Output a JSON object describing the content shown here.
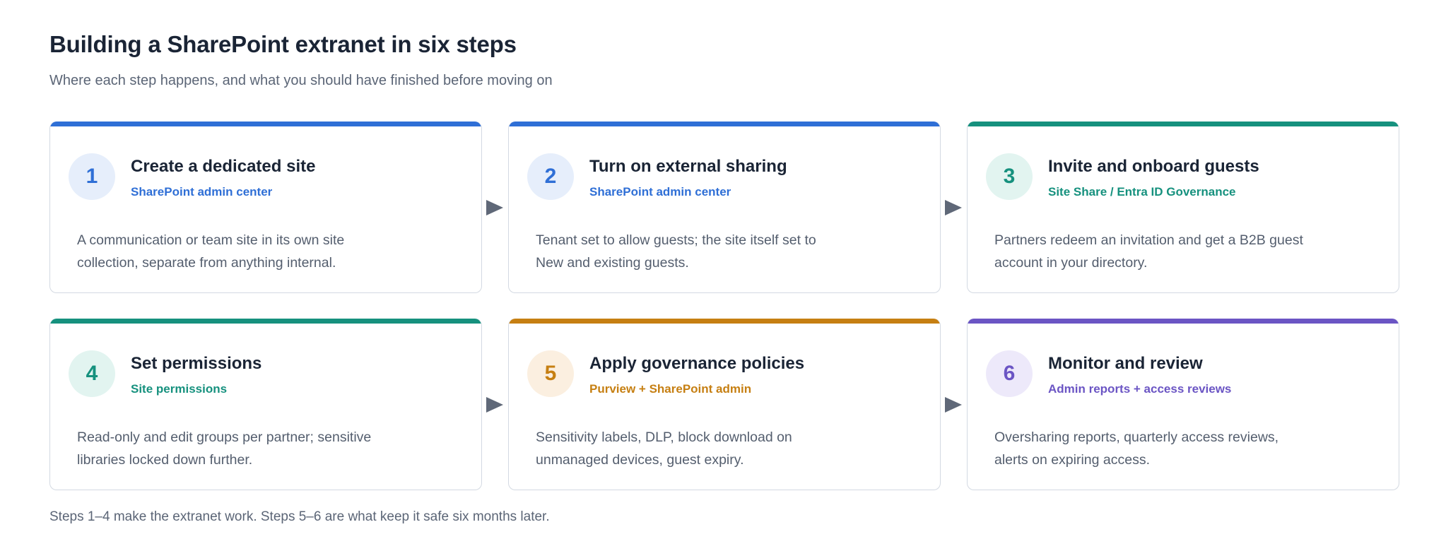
{
  "title": "Building a SharePoint extranet in six steps",
  "subtitle": "Where each step happens, and what you should have finished before moving on",
  "steps": [
    {
      "number": "1",
      "title": "Create a dedicated site",
      "location": "SharePoint admin center",
      "description": "A communication or team site in its own site collection, separate from anything internal.",
      "accent": "#2f6fd6",
      "badge_bg": "#e6eefb"
    },
    {
      "number": "2",
      "title": "Turn on external sharing",
      "location": "SharePoint admin center",
      "description": "Tenant set to allow guests; the site itself set to New and existing guests.",
      "accent": "#2f6fd6",
      "badge_bg": "#e6eefb"
    },
    {
      "number": "3",
      "title": "Invite and onboard guests",
      "location": "Site Share / Entra ID Governance",
      "description": "Partners redeem an invitation and get a B2B guest account in your directory.",
      "accent": "#16917e",
      "badge_bg": "#e2f4f0"
    },
    {
      "number": "4",
      "title": "Set permissions",
      "location": "Site permissions",
      "description": "Read-only and edit groups per partner; sensitive libraries locked down further.",
      "accent": "#16917e",
      "badge_bg": "#e2f4f0"
    },
    {
      "number": "5",
      "title": "Apply governance policies",
      "location": "Purview + SharePoint admin",
      "description": "Sensitivity labels, DLP, block download on unmanaged devices, guest expiry.",
      "accent": "#c67f12",
      "badge_bg": "#fbefe0"
    },
    {
      "number": "6",
      "title": "Monitor and review",
      "location": "Admin reports + access reviews",
      "description": "Oversharing reports, quarterly access reviews, alerts on expiring access.",
      "accent": "#6b55c4",
      "badge_bg": "#ede9fa"
    }
  ],
  "footnote": "Steps 1–4 make the extranet work. Steps 5–6 are what keep it safe six months later.",
  "colors": {
    "arrow": "#5f6878",
    "card_border": "#d3d9e2"
  }
}
